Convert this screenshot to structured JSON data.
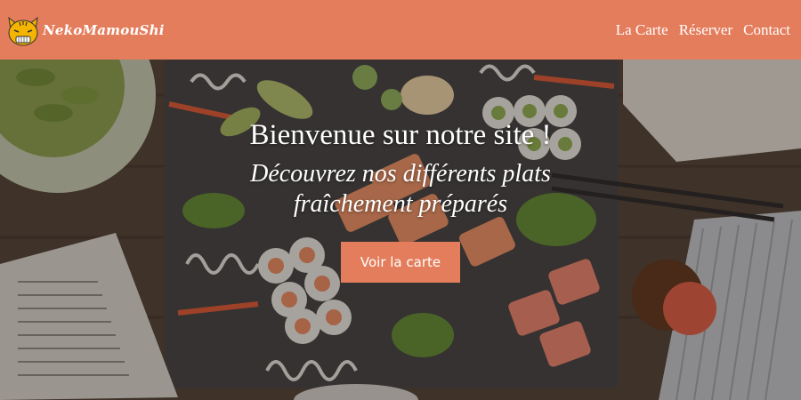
{
  "brand": {
    "name": "NekoMamouShi",
    "logo_icon": "cat-face-icon"
  },
  "nav": {
    "items": [
      {
        "label": "La Carte"
      },
      {
        "label": "Réserver"
      },
      {
        "label": "Contact"
      }
    ]
  },
  "hero": {
    "title": "Bienvenue sur notre site !",
    "subtitle_line1": "Découvrez nos différents plats",
    "subtitle_line2": "fraîchement préparés",
    "cta_label": "Voir la carte",
    "background_image": "sushi-platter-photo"
  },
  "colors": {
    "accent": "#e47d5c",
    "text": "#ffffff"
  }
}
